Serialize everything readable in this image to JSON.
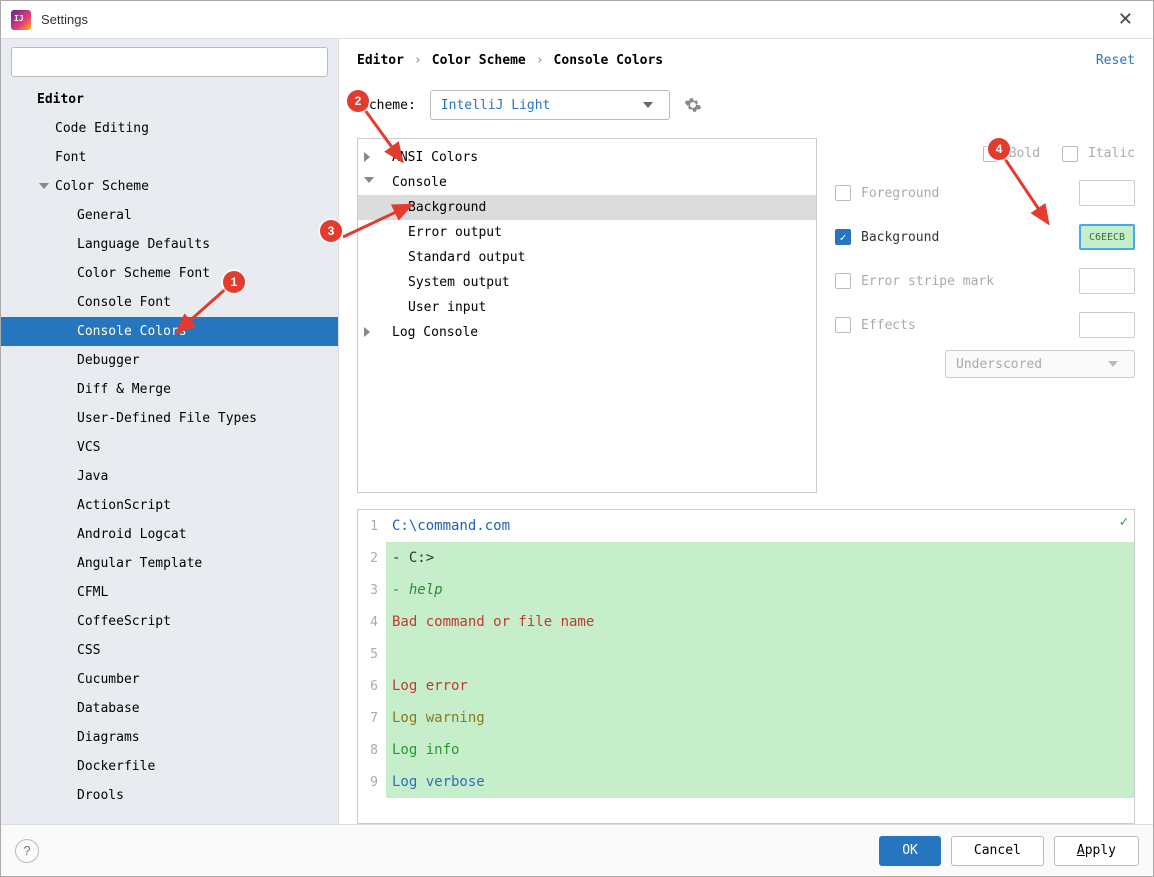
{
  "window": {
    "title": "Settings"
  },
  "sidebar": {
    "search_placeholder": "",
    "group": "Editor",
    "items": [
      "Code Editing",
      "Font"
    ],
    "color_scheme_label": "Color Scheme",
    "color_scheme_items": [
      "General",
      "Language Defaults",
      "Color Scheme Font",
      "Console Font",
      "Console Colors",
      "Debugger",
      "Diff & Merge",
      "User-Defined File Types",
      "VCS",
      "Java",
      "ActionScript",
      "Android Logcat",
      "Angular Template",
      "CFML",
      "CoffeeScript",
      "CSS",
      "Cucumber",
      "Database",
      "Diagrams",
      "Dockerfile",
      "Drools"
    ],
    "selected_index": 4
  },
  "breadcrumb": [
    "Editor",
    "Color Scheme",
    "Console Colors"
  ],
  "reset_label": "Reset",
  "scheme": {
    "label": "Scheme:",
    "value": "IntelliJ Light"
  },
  "color_tree": {
    "groups": [
      {
        "label": "ANSI Colors",
        "expanded": false,
        "children": []
      },
      {
        "label": "Console",
        "expanded": true,
        "children": [
          "Background",
          "Error output",
          "Standard output",
          "System output",
          "User input"
        ]
      },
      {
        "label": "Log Console",
        "expanded": false,
        "children": []
      }
    ],
    "selected": "Background"
  },
  "options": {
    "bold": {
      "label": "Bold",
      "checked": false,
      "enabled": false
    },
    "italic": {
      "label": "Italic",
      "checked": false,
      "enabled": false
    },
    "foreground": {
      "label": "Foreground",
      "checked": false,
      "enabled": false
    },
    "background": {
      "label": "Background",
      "checked": true,
      "enabled": true,
      "color": "C6EECB"
    },
    "error_stripe": {
      "label": "Error stripe mark",
      "checked": false,
      "enabled": false
    },
    "effects": {
      "label": "Effects",
      "checked": false,
      "enabled": false,
      "value": "Underscored"
    }
  },
  "preview": {
    "lines": [
      {
        "n": 1,
        "text": "C:\\command.com",
        "cls": "c-blue",
        "bg": false
      },
      {
        "n": 2,
        "text": "- C:>",
        "cls": "c-dark",
        "bg": true
      },
      {
        "n": 3,
        "text": "- help",
        "cls": "c-green-italic",
        "bg": true
      },
      {
        "n": 4,
        "text": "Bad command or file name",
        "cls": "c-red",
        "bg": true
      },
      {
        "n": 5,
        "text": "",
        "cls": "c-dark",
        "bg": true
      },
      {
        "n": 6,
        "text": "Log error",
        "cls": "c-red",
        "bg": true
      },
      {
        "n": 7,
        "text": "Log warning",
        "cls": "c-olive",
        "bg": true
      },
      {
        "n": 8,
        "text": "Log info",
        "cls": "c-green",
        "bg": true
      },
      {
        "n": 9,
        "text": "Log verbose",
        "cls": "c-logblue",
        "bg": true
      }
    ]
  },
  "footer": {
    "ok": "OK",
    "cancel": "Cancel",
    "apply": "Apply"
  },
  "markers": [
    "1",
    "2",
    "3",
    "4"
  ]
}
